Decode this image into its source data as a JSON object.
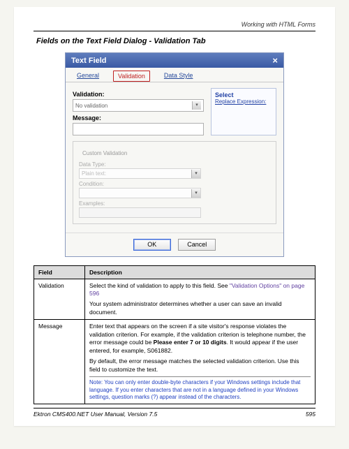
{
  "header": {
    "breadcrumb": "Working with HTML Forms"
  },
  "section_title": "Fields on the Text Field Dialog - Validation Tab",
  "dialog": {
    "title": "Text Field",
    "tabs": {
      "general": "General",
      "validation": "Validation",
      "datastyle": "Data Style"
    },
    "labels": {
      "validation": "Validation:",
      "validation_value": "No validation",
      "message": "Message:",
      "custom": "Custom Validation",
      "datatype": "Data Type:",
      "plaintext": "Plain text:",
      "condition": "Condition:",
      "examples": "Examples:"
    },
    "side": {
      "title": "Select",
      "link": "Replace Expression:"
    },
    "buttons": {
      "ok": "OK",
      "cancel": "Cancel"
    }
  },
  "table": {
    "headers": {
      "field": "Field",
      "description": "Description"
    },
    "rows": {
      "validation": {
        "field": "Validation",
        "desc1": "Select the kind of validation to apply to this field. See ",
        "link": "\"Validation Options\" on page 596",
        "desc2": "Your system administrator determines whether a user can save an invalid document."
      },
      "message": {
        "field": "Message",
        "p1a": "Enter text that appears on the screen if a site visitor's response violates the validation criterion. For example, if the validation criterion is telephone number, the error message could be ",
        "p1b": "Please enter 7 or 10 digits",
        "p1c": ". It would appear if the user entered, for example, S061882.",
        "p2": "By default, the error message matches the selected validation criterion. Use this field to customize the text.",
        "note": "Note: You can only enter double-byte characters if your Windows settings include that language. If you enter characters that are not in a language defined in your Windows settings, question marks (?) appear instead of the characters."
      }
    }
  },
  "footer": {
    "left": "Ektron CMS400.NET User Manual, Version 7.5",
    "right": "595"
  }
}
